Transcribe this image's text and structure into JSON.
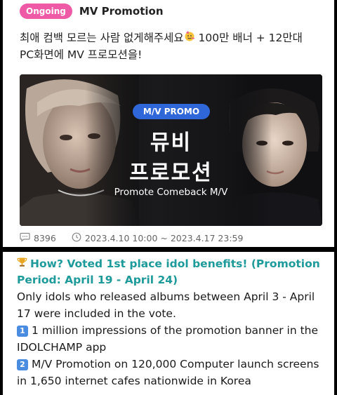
{
  "card": {
    "status_badge": "Ongoing",
    "title": "MV Promotion",
    "desc_part1": "최애 컴백 모르는 사람 없게해주세요",
    "desc_emoji": "party-face-icon",
    "desc_part2": " 100만 배너 + 12만대",
    "desc_line2": "PC화면에 MV 프로모션을!",
    "banner": {
      "pill": "M/V PROMO",
      "headline1": "뮤비",
      "headline2": "프로모션",
      "subtitle": "Promote Comeback M/V"
    },
    "comment_count": "8396",
    "date_range": "2023.4.10 10:00 ~ 2023.4.17 23:59"
  },
  "post": {
    "heading_icon": "trophy-icon",
    "heading": "How? Voted 1st place idol benefits! (Promotion Period: April 19 - April 24)",
    "line1": "Only idols who released albums between April 3 - April 17 were included in the vote.",
    "item1_key": "1",
    "item1": "1 million impressions of the promotion banner in the IDOLCHAMP app",
    "item2_key": "2",
    "item2": "M/V Promotion on 120,000 Computer launch screens in 1,650 internet cafes nationwide in Korea"
  },
  "colors": {
    "badge": "#ee5aa6",
    "heading": "#1e9a9a",
    "promo_pill": "#2f67d8",
    "keycap": "#4a8de0"
  }
}
